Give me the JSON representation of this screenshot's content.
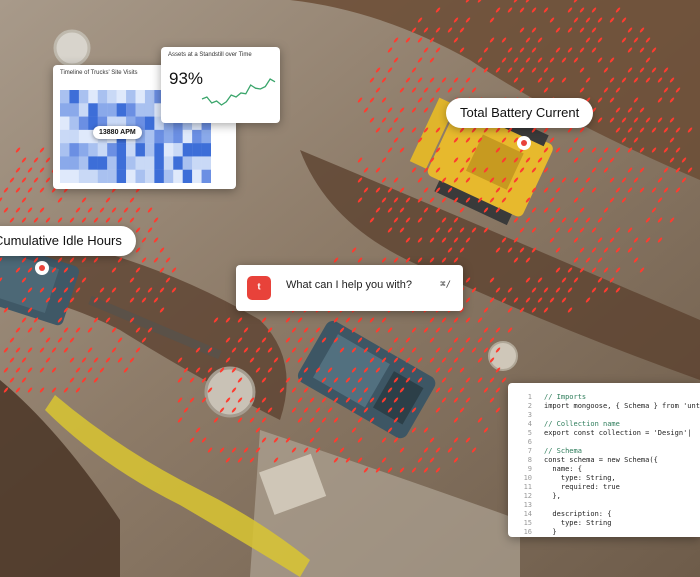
{
  "labels": {
    "battery": "Total Battery Current",
    "idle": "Cumulative Idle Hours"
  },
  "timeline_card": {
    "title": "Timeline of Trucks' Site Visits",
    "tooltip": "13880 APM"
  },
  "assets_card": {
    "title": "Assets at a Standstill over Time",
    "value": "93%",
    "trend": [
      0.45,
      0.5,
      0.35,
      0.4,
      0.3,
      0.38,
      0.55,
      0.5,
      0.6,
      0.58,
      0.8,
      0.72,
      0.7,
      0.76,
      0.95,
      0.88
    ]
  },
  "assistant": {
    "prompt": "What can I help you with?",
    "shortcut": "⌘/"
  },
  "code_panel": {
    "line_numbers": [
      "1",
      "2",
      "3",
      "4",
      "5",
      "6",
      "7",
      "8",
      "9",
      "10",
      "11",
      "12",
      "13",
      "14",
      "15",
      "16"
    ],
    "lines": [
      "// Imports",
      "import mongoose, { Schema } from 'untitl",
      "",
      "// Collection name",
      "export const collection = 'Design'|",
      "",
      "// Schema",
      "const schema = new Schema({",
      "  name: {",
      "    type: String,",
      "    required: true",
      "  },",
      "",
      "  description: {",
      "    type: String",
      "  }"
    ]
  },
  "colors": {
    "accent": "#e8423a",
    "heat_dark": "#3d6ed8",
    "heat_light": "#dfe9fb",
    "spark": "#3aa56b",
    "dots": "#ff3b2f"
  },
  "icons": [
    "assistant-logo-icon",
    "location-pin-icon"
  ]
}
